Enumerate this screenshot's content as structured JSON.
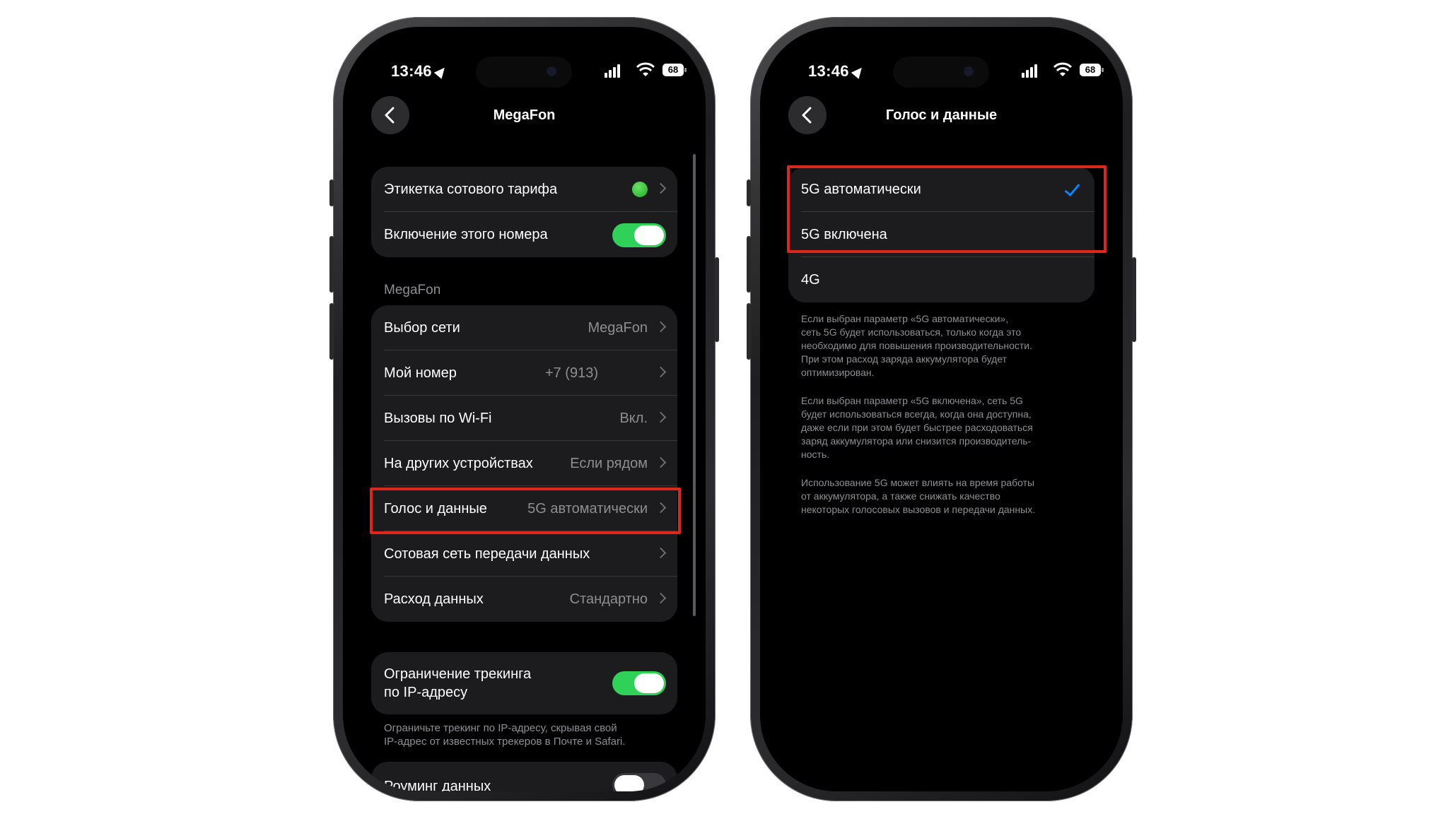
{
  "status_bar": {
    "time": "13:46",
    "battery": "68"
  },
  "left_screen": {
    "title": "MegaFon",
    "group1": [
      {
        "label": "Этикетка сотового тарифа"
      },
      {
        "label": "Включение этого номера",
        "toggle": "on"
      }
    ],
    "section_header": "MegaFon",
    "group2": [
      {
        "label": "Выбор сети",
        "value": "MegaFon"
      },
      {
        "label": "Мой номер",
        "value": "+7 (913)"
      },
      {
        "label": "Вызовы по Wi-Fi",
        "value": "Вкл."
      },
      {
        "label": "На других устройствах",
        "value": "Если рядом"
      },
      {
        "label": "Голос и данные",
        "value": "5G автоматически"
      },
      {
        "label": "Сотовая сеть передачи данных",
        "value": ""
      },
      {
        "label": "Расход данных",
        "value": "Стандартно"
      }
    ],
    "tracking": {
      "label_line1": "Ограничение трекинга",
      "label_line2": "по IP-адресу",
      "toggle": "on"
    },
    "tracking_note_line1": "Ограничьте трекинг по IP-адресу, скрывая свой",
    "tracking_note_line2": "IP-адрес от известных трекеров в Почте и Safari.",
    "roaming": {
      "label": "Роуминг данных",
      "toggle": "off"
    }
  },
  "right_screen": {
    "title": "Голос и данные",
    "options": [
      {
        "label": "5G автоматически",
        "selected": true
      },
      {
        "label": "5G включена",
        "selected": false
      },
      {
        "label": "4G",
        "selected": false
      }
    ],
    "para1": [
      "Если выбран параметр «5G автоматически»,",
      "сеть 5G будет использоваться, только когда это",
      "необходимо для повышения производительности.",
      "При этом расход заряда аккумулятора будет",
      "оптимизирован."
    ],
    "para2": [
      "Если выбран параметр «5G включена», сеть 5G",
      "будет использоваться всегда, когда она доступна,",
      "даже если при этом будет быстрее расходоваться",
      "заряд аккумулятора или снизится производитель-",
      "ность."
    ],
    "para3": [
      "Использование 5G может влиять на время работы",
      "от аккумулятора, а также снижать качество",
      "некоторых голосовых вызовов и передачи данных."
    ]
  },
  "colors": {
    "highlight": "#e0261a",
    "toggle_on": "#30d158",
    "checkmark": "#0a84ff"
  }
}
